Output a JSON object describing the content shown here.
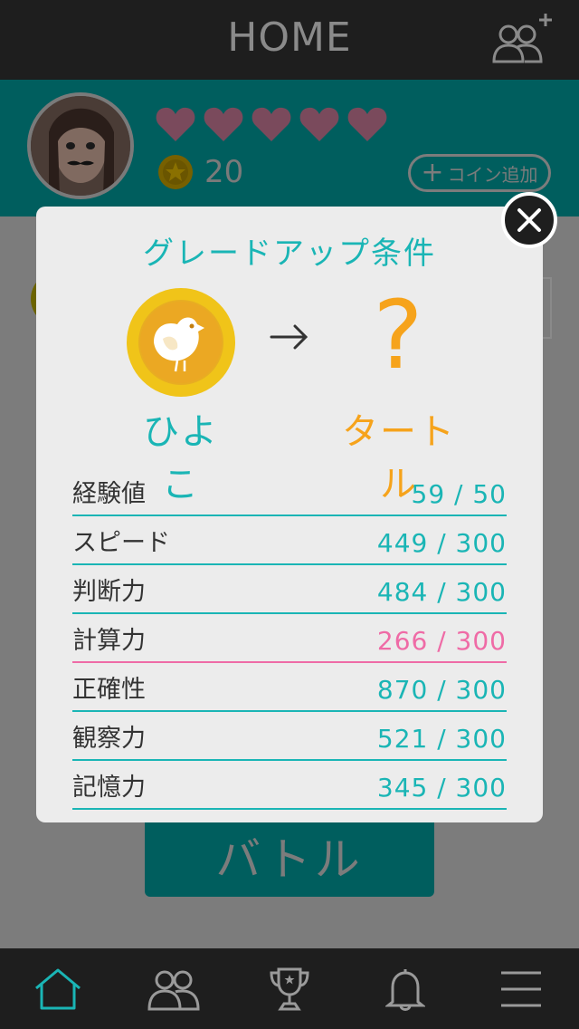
{
  "header": {
    "title": "HOME"
  },
  "profile": {
    "hearts": 5,
    "coins": "20",
    "coin_add_label": "コイン追加"
  },
  "modal": {
    "title": "グレードアップ条件",
    "current_grade": "ひよこ",
    "next_grade": "タートル",
    "unknown_symbol": "?",
    "stats": [
      {
        "name": "経験値",
        "value": "59 / 50",
        "met": true
      },
      {
        "name": "スピード",
        "value": "449 / 300",
        "met": true
      },
      {
        "name": "判断力",
        "value": "484 / 300",
        "met": true
      },
      {
        "name": "計算力",
        "value": "266 / 300",
        "met": false
      },
      {
        "name": "正確性",
        "value": "870 / 300",
        "met": true
      },
      {
        "name": "観察力",
        "value": "521 / 300",
        "met": true
      },
      {
        "name": "記憶力",
        "value": "345 / 300",
        "met": true
      }
    ]
  },
  "battle_button": {
    "label": "バトル"
  },
  "nav": {
    "items": [
      "home-icon",
      "friends-icon",
      "trophy-icon",
      "bell-icon",
      "menu-icon"
    ],
    "active": "home-icon"
  },
  "colors": {
    "accent": "#1ab5b5",
    "warning": "#ef6ba6",
    "gold": "#f6a31b",
    "coin": "#f0c419"
  }
}
